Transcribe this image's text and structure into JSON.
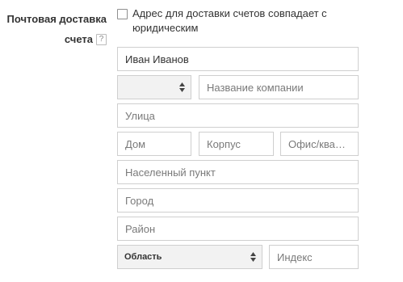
{
  "form": {
    "label_line1": "Почтовая доставка",
    "label_line2": "счета",
    "help_symbol": "?",
    "same_address_label": "Адрес для доставки счетов совпадает с юридическим",
    "recipient_name": "Иван Иванов",
    "org_type_value": "",
    "company_placeholder": "Название компании",
    "street_placeholder": "Улица",
    "house_placeholder": "Дом",
    "building_placeholder": "Корпус",
    "office_placeholder": "Офис/квартира",
    "settlement_placeholder": "Населенный пункт",
    "city_placeholder": "Город",
    "district_placeholder": "Район",
    "region_value": "Область",
    "postcode_placeholder": "Индекс"
  }
}
